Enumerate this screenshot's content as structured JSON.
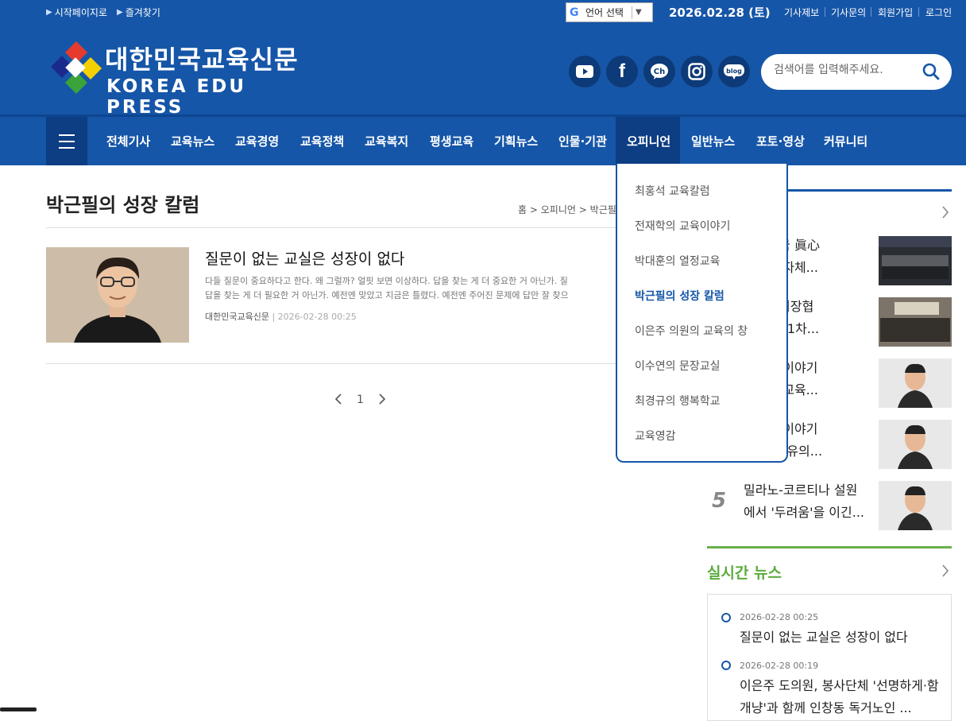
{
  "top_bar": {
    "links": [
      "시작페이지로",
      "즐겨찾기"
    ],
    "language_label": "언어 선택",
    "date": "2026.02.28 (토)",
    "util_links": [
      "기사제보",
      "기사문의",
      "회원가입",
      "로그인"
    ]
  },
  "logo": {
    "korean": "대한민국교육신문",
    "english": "KOREA EDU PRESS"
  },
  "social_icons": [
    "youtube-icon",
    "facebook-icon",
    "kakao-channel-icon",
    "instagram-icon",
    "blog-icon"
  ],
  "search": {
    "placeholder": "검색어를 입력해주세요."
  },
  "nav": {
    "items": [
      "전체기사",
      "교육뉴스",
      "교육경영",
      "교육정책",
      "교육복지",
      "평생교육",
      "기획뉴스",
      "인물·기관",
      "오피니언",
      "일반뉴스",
      "포토·영상",
      "커뮤니티"
    ],
    "active": "오피니언"
  },
  "dropdown": {
    "items": [
      "최홍석 교육칼럼",
      "전재학의 교육이야기",
      "박대훈의 열정교육",
      "박근필의 성장 칼럼",
      "이은주 의원의 교육의 창",
      "이수연의 문장교실",
      "최경규의 행복학교",
      "교육영감"
    ],
    "active": "박근필의 성장 칼럼"
  },
  "page": {
    "title": "박근필의 성장 칼럼",
    "breadcrumb": [
      "홈",
      "오피니언",
      "박근필"
    ]
  },
  "article": {
    "title": "질문이 없는 교실은 성장이 없다",
    "summary_line1": "다들 질문이 중요하다고 한다. 왜 그럴까? 얼핏 보면 이상하다. 답을 찾는 게 더 중요한 거 아닌가. 질",
    "summary_line2": "답을 찾는 게 더 필요한 거 아닌가. 예전엔 맞았고 지금은 틀렸다. 예전엔 주어진 문제에 답만 잘 찾으",
    "source": "대한민국교육신문",
    "date": "2026-02-28 00:25"
  },
  "pagination": {
    "current": "1"
  },
  "ranking": [
    {
      "line1": "대한민국 眞心",
      "line2": "육감·지자체..."
    },
    {
      "line1": "도교총회장협",
      "line2": "26년 제1차..."
    },
    {
      "line1": "의 교육이야기",
      "line2": "한민국 교육..."
    },
    {
      "line1": "의 교육이야기",
      "line2": "시대, 사유의..."
    },
    {
      "number": "5",
      "line1": "밀라노-코르티나 설원",
      "line2": "에서 '두려움'을 이긴..."
    }
  ],
  "live_news": {
    "title": "실시간 뉴스",
    "items": [
      {
        "date": "2026-02-28 00:25",
        "headline": "질문이 없는 교실은 성장이 없다"
      },
      {
        "date": "2026-02-28 00:19",
        "headline": "이은주 도의원, 봉사단체 '선명하게·함개냥'과 함께 인창동 독거노인 ..."
      }
    ]
  },
  "colors": {
    "header_blue": "#1656a8",
    "dark_blue": "#0d3d82",
    "live_green": "#5aac3c"
  }
}
